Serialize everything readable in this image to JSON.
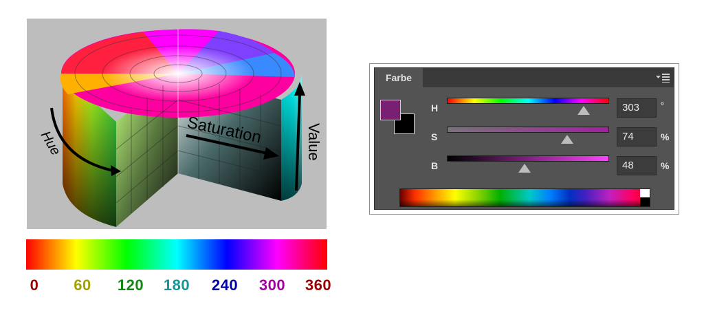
{
  "illustration": {
    "hue_label": "Hue",
    "saturation_label": "Saturation",
    "value_label": "Value"
  },
  "hue_scale": {
    "labels": [
      {
        "text": "0",
        "color": "#9b0000"
      },
      {
        "text": "60",
        "color": "#a3a300"
      },
      {
        "text": "120",
        "color": "#0f8a0f"
      },
      {
        "text": "180",
        "color": "#159595"
      },
      {
        "text": "240",
        "color": "#0000a8"
      },
      {
        "text": "300",
        "color": "#a300a3"
      },
      {
        "text": "360",
        "color": "#9b0000"
      }
    ]
  },
  "panel": {
    "tab_label": "Farbe",
    "foreground_color": "#7a2073",
    "background_color": "#000000",
    "channels": {
      "h": {
        "label": "H",
        "value": "303",
        "unit": "°",
        "level": 0.842
      },
      "s": {
        "label": "S",
        "value": "74",
        "unit": "%",
        "level": 0.74
      },
      "b": {
        "label": "B",
        "value": "48",
        "unit": "%",
        "level": 0.48
      }
    }
  }
}
